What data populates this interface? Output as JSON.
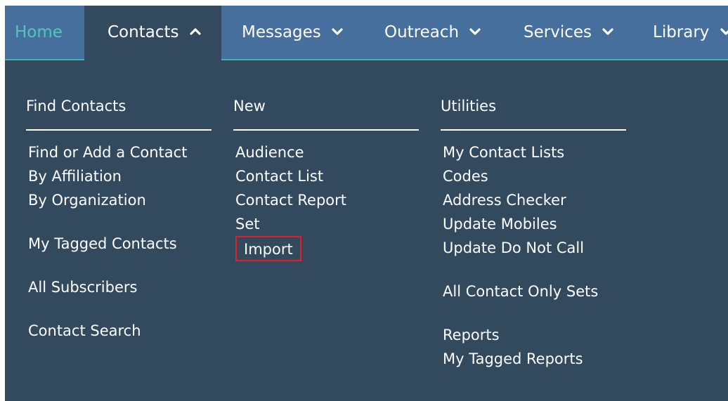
{
  "nav": {
    "home": "Home",
    "contacts": "Contacts",
    "messages": "Messages",
    "outreach": "Outreach",
    "services": "Services",
    "library": "Library"
  },
  "columns": {
    "find": {
      "heading": "Find Contacts",
      "items": [
        "Find or Add a Contact",
        "By Affiliation",
        "By Organization",
        "My Tagged Contacts",
        "All Subscribers",
        "Contact Search"
      ]
    },
    "new": {
      "heading": "New",
      "items": [
        "Audience",
        "Contact List",
        "Contact Report",
        "Set",
        "Import"
      ]
    },
    "utilities": {
      "heading": "Utilities",
      "items": [
        "My Contact Lists",
        "Codes",
        "Address Checker",
        "Update Mobiles",
        "Update Do Not Call",
        "All Contact Only Sets",
        "Reports",
        "My Tagged Reports"
      ]
    }
  },
  "colors": {
    "nav_bg": "#466f9d",
    "menu_bg": "#33495e",
    "home_accent": "#4fc7bd",
    "highlight": "#e01f26"
  },
  "icons": {
    "contacts_chevron": "chevron-up-icon",
    "other_chevron": "chevron-down-icon"
  }
}
